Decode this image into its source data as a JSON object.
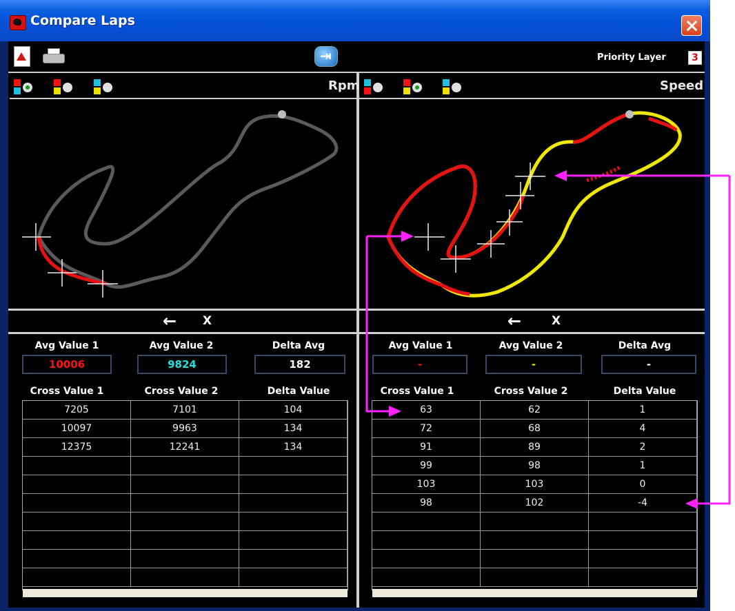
{
  "window": {
    "title": "Compare Laps"
  },
  "toolbar": {
    "priority_label": "Priority Layer",
    "priority_value": "3"
  },
  "left": {
    "channel": "Rpm",
    "nav_back": "←",
    "nav_close": "X",
    "stats": {
      "headers": [
        "Avg Value 1",
        "Avg Value 2",
        "Delta Avg"
      ],
      "values": [
        "10006",
        "9824",
        "182"
      ],
      "colors": [
        "#FF1010",
        "#20E0E0",
        "#FFFFFF"
      ]
    },
    "table": {
      "headers": [
        "Cross Value 1",
        "Cross Value 2",
        "Delta Value"
      ],
      "rows": [
        [
          "7205",
          "7101",
          "104"
        ],
        [
          "10097",
          "9963",
          "134"
        ],
        [
          "12375",
          "12241",
          "134"
        ],
        [
          "",
          "",
          ""
        ],
        [
          "",
          "",
          ""
        ],
        [
          "",
          "",
          ""
        ],
        [
          "",
          "",
          ""
        ],
        [
          "",
          "",
          ""
        ],
        [
          "",
          "",
          ""
        ],
        [
          "",
          "",
          ""
        ]
      ]
    }
  },
  "right": {
    "channel": "Speed",
    "nav_back": "←",
    "nav_close": "X",
    "stats": {
      "headers": [
        "Avg Value 1",
        "Avg Value 2",
        "Delta Avg"
      ],
      "values": [
        "-",
        "-",
        "-"
      ],
      "colors": [
        "#FF1010",
        "#E0E020",
        "#FFFFFF"
      ]
    },
    "table": {
      "headers": [
        "Cross Value 1",
        "Cross Value 2",
        "Delta Value"
      ],
      "rows": [
        [
          "63",
          "62",
          "1"
        ],
        [
          "72",
          "68",
          "4"
        ],
        [
          "91",
          "89",
          "2"
        ],
        [
          "99",
          "98",
          "1"
        ],
        [
          "103",
          "103",
          "0"
        ],
        [
          "98",
          "102",
          "-4"
        ],
        [
          "",
          "",
          ""
        ],
        [
          "",
          "",
          ""
        ],
        [
          "",
          "",
          ""
        ],
        [
          "",
          "",
          ""
        ]
      ]
    }
  },
  "legend": [
    {
      "top": "#FF1010",
      "bottom": "#20C0E0",
      "selected": true
    },
    {
      "top": "#FF1010",
      "bottom": "#F0E000",
      "selected": false
    },
    {
      "top": "#20C0E0",
      "bottom": "#F0E000",
      "selected": false
    }
  ],
  "legend_right": [
    {
      "top": "#20C0E0",
      "bottom": "#FF1010",
      "selected": false
    },
    {
      "top": "#FF1010",
      "bottom": "#F0E000",
      "selected": true
    },
    {
      "top": "#20C0E0",
      "bottom": "#F0E000",
      "selected": false
    }
  ],
  "colors": {
    "track_gray": "#5A5A5A",
    "lap_red": "#E81010",
    "lap_yellow": "#F0E800",
    "annotation": "#FF22FF"
  }
}
